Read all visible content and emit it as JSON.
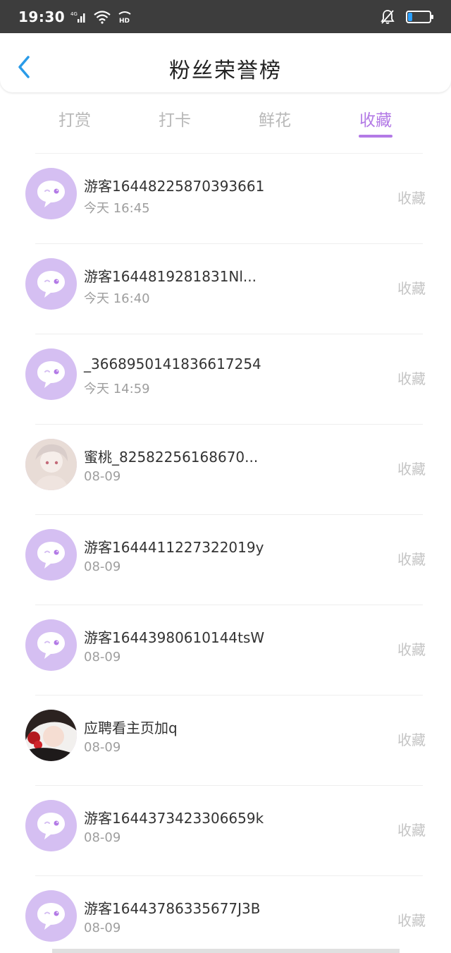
{
  "status_bar": {
    "time": "19:30",
    "net": "4G",
    "hd": "HD"
  },
  "header": {
    "title": "粉丝荣誉榜"
  },
  "tabs": [
    {
      "label": "打赏",
      "active": false
    },
    {
      "label": "打卡",
      "active": false
    },
    {
      "label": "鲜花",
      "active": false
    },
    {
      "label": "收藏",
      "active": true
    }
  ],
  "colors": {
    "accent": "#b37ae6",
    "avatar_bg": "#d5bff2",
    "status_bar": "#3d3d3d",
    "battery": "#2aa0ff"
  },
  "list": [
    {
      "name": "游客16448225870393661",
      "time": "今天 16:45",
      "action": "收藏",
      "avatar": "default-chat-icon"
    },
    {
      "name": "游客1644819281831Nl...",
      "time": "今天 16:40",
      "action": "收藏",
      "avatar": "default-chat-icon"
    },
    {
      "name": "_3668950141836617254",
      "time": "今天 14:59",
      "action": "收藏",
      "avatar": "default-chat-icon"
    },
    {
      "name": "蜜桃_82582256168670...",
      "time": "08-09",
      "action": "收藏",
      "avatar": "photo-avatar-light"
    },
    {
      "name": "游客1644411227322019y",
      "time": "08-09",
      "action": "收藏",
      "avatar": "default-chat-icon"
    },
    {
      "name": "游客16443980610144tsW",
      "time": "08-09",
      "action": "收藏",
      "avatar": "default-chat-icon"
    },
    {
      "name": "应聘看主页加q",
      "time": "08-09",
      "action": "收藏",
      "avatar": "photo-avatar-dark"
    },
    {
      "name": "游客1644373423306659k",
      "time": "08-09",
      "action": "收藏",
      "avatar": "default-chat-icon"
    },
    {
      "name": "游客16443786335677J3B",
      "time": "08-09",
      "action": "收藏",
      "avatar": "default-chat-icon"
    }
  ]
}
